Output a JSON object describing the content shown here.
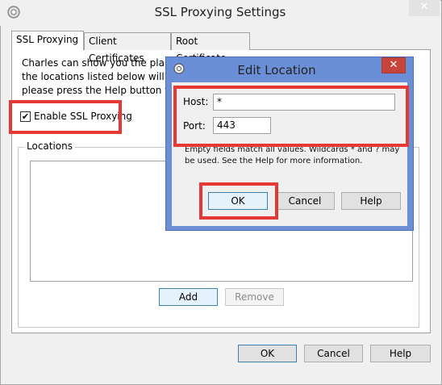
{
  "main_window": {
    "title": "SSL Proxying Settings",
    "tabs": [
      "SSL Proxying",
      "Client Certificates",
      "Root Certificate"
    ],
    "intro_text": "Charles can show you the plain\nthe locations listed below will b\nplease press the Help button fo",
    "enable_label": "Enable SSL Proxying",
    "enable_checked": true,
    "locations_label": "Locations",
    "buttons": {
      "add": "Add",
      "remove": "Remove",
      "ok": "OK",
      "cancel": "Cancel",
      "help": "Help"
    }
  },
  "edit_dialog": {
    "title": "Edit Location",
    "host_label": "Host:",
    "host_value": "*",
    "port_label": "Port:",
    "port_value": "443",
    "hint": "Empty fields match all values. Wildcards * and ? may be used. See the Help for more information.",
    "buttons": {
      "ok": "OK",
      "cancel": "Cancel",
      "help": "Help"
    }
  },
  "icons": {
    "app": "charles-app-icon",
    "close": "close-icon"
  },
  "colors": {
    "highlight": "#e53935",
    "dialog_frame": "#6a8fd6",
    "close_button": "#c7443a"
  }
}
